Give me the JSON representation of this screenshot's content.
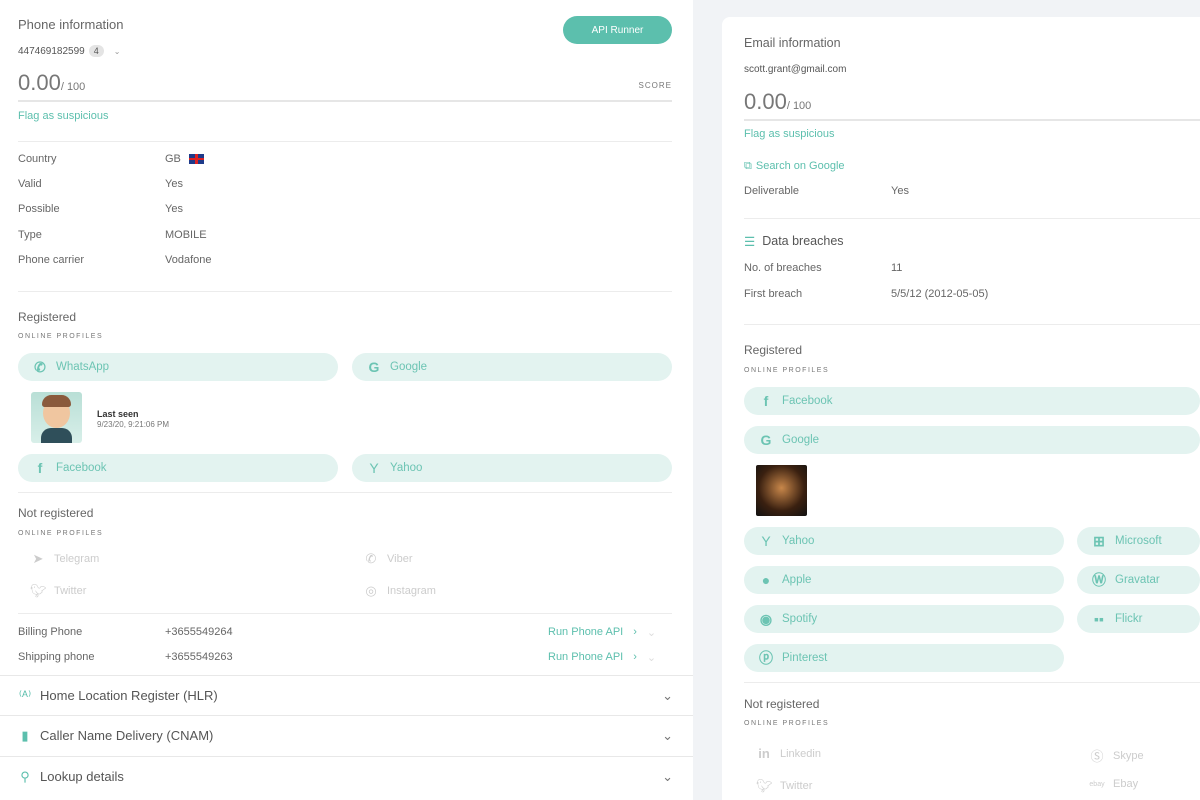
{
  "phone": {
    "title": "Phone information",
    "number": "447469182599",
    "count_badge": "4",
    "api_runner": "API Runner",
    "score": "0.00",
    "score_max": "/ 100",
    "score_label": "SCORE",
    "flag": "Flag as suspicious",
    "fields": [
      {
        "label": "Country",
        "value": "GB"
      },
      {
        "label": "Valid",
        "value": "Yes"
      },
      {
        "label": "Possible",
        "value": "Yes"
      },
      {
        "label": "Type",
        "value": "MOBILE"
      },
      {
        "label": "Phone carrier",
        "value": "Vodafone"
      }
    ],
    "registered": {
      "title": "Registered",
      "caption": "ONLINE PROFILES",
      "profiles": [
        "WhatsApp",
        "Google",
        "Facebook",
        "Yahoo"
      ],
      "last_seen_label": "Last seen",
      "last_seen_value": "9/23/20, 9:21:06 PM"
    },
    "not_registered": {
      "title": "Not registered",
      "caption": "ONLINE PROFILES",
      "profiles": [
        "Telegram",
        "Viber",
        "Twitter",
        "Instagram"
      ]
    },
    "billing": {
      "label": "Billing Phone",
      "value": "+3655549264",
      "action": "Run Phone API"
    },
    "shipping": {
      "label": "Shipping phone",
      "value": "+3655549263",
      "action": "Run Phone API"
    },
    "accordions": [
      "Home Location Register (HLR)",
      "Caller Name Delivery (CNAM)",
      "Lookup details"
    ]
  },
  "email": {
    "title": "Email information",
    "address": "scott.grant@gmail.com",
    "score": "0.00",
    "score_max": "/ 100",
    "flag": "Flag as suspicious",
    "search_google": "Search on Google",
    "deliverable": {
      "label": "Deliverable",
      "value": "Yes"
    },
    "breaches": {
      "title": "Data breaches",
      "count_label": "No. of breaches",
      "count": "11",
      "first_label": "First breach",
      "first": "5/5/12 (2012-05-05)"
    },
    "registered": {
      "title": "Registered",
      "caption": "ONLINE PROFILES",
      "profiles": [
        "Facebook",
        "Google",
        "Yahoo",
        "Microsoft",
        "Apple",
        "Gravatar",
        "Spotify",
        "Flickr",
        "Pinterest"
      ]
    },
    "not_registered": {
      "title": "Not registered",
      "caption": "ONLINE PROFILES",
      "profiles": [
        "Linkedin",
        "Skype",
        "Twitter",
        "Ebay"
      ]
    }
  },
  "colors": {
    "accent": "#5cbfad",
    "pill_bg": "#e3f3f0",
    "background": "#f1f3f6"
  }
}
